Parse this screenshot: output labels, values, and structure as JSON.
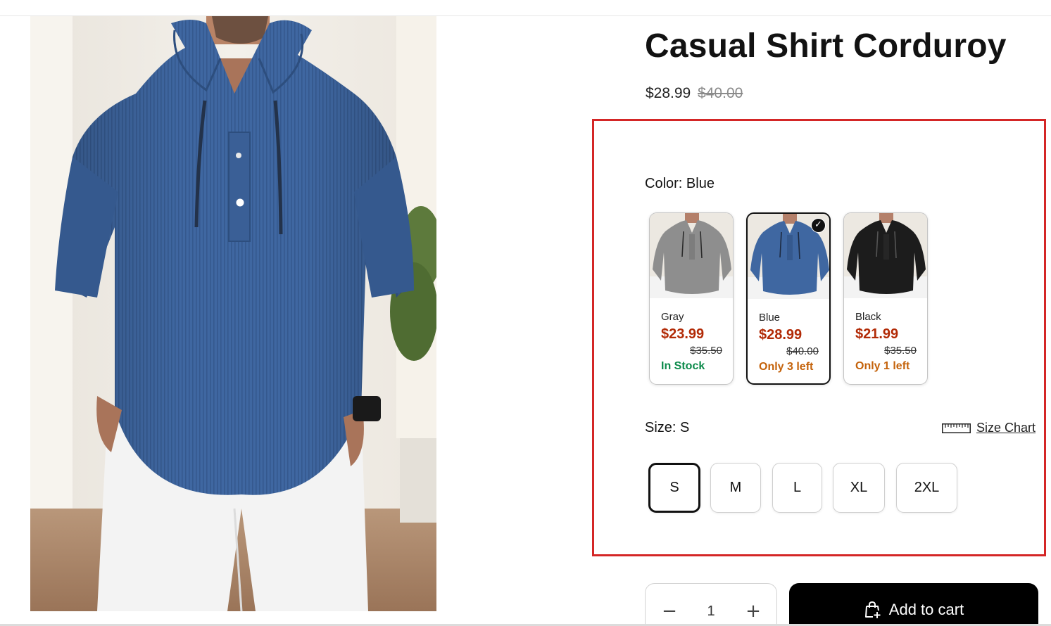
{
  "product": {
    "title": "Casual Shirt Corduroy",
    "price": "$28.99",
    "compare_price": "$40.00"
  },
  "color": {
    "label": "Color: Blue",
    "options": [
      {
        "name": "Gray",
        "price": "$23.99",
        "old_price": "$35.50",
        "stock": "In Stock",
        "stock_color": "#0b8a4a",
        "shirt_color": "#8e8e8e",
        "selected": false
      },
      {
        "name": "Blue",
        "price": "$28.99",
        "old_price": "$40.00",
        "stock": "Only 3 left",
        "stock_color": "#c4620a",
        "shirt_color": "#3f67a1",
        "selected": true
      },
      {
        "name": "Black",
        "price": "$21.99",
        "old_price": "$35.50",
        "stock": "Only 1 left",
        "stock_color": "#c4620a",
        "shirt_color": "#1c1c1c",
        "selected": false
      }
    ],
    "check_icon": "check-icon"
  },
  "size": {
    "label": "Size: S",
    "chart_link": "Size Chart",
    "chart_icon": "ruler-icon",
    "options": [
      "S",
      "M",
      "L",
      "XL",
      "2XL"
    ],
    "selected": "S"
  },
  "quantity": {
    "value": "1",
    "minus_icon": "minus-icon",
    "plus_icon": "plus-icon"
  },
  "cart": {
    "label": "Add to cart",
    "icon": "shopping-bag-plus-icon"
  },
  "colors": {
    "highlight": "#d42626",
    "sale_price": "#b22a06",
    "in_stock": "#0b8a4a",
    "low_stock": "#c4620a",
    "main_shirt": "#3f67a1"
  }
}
